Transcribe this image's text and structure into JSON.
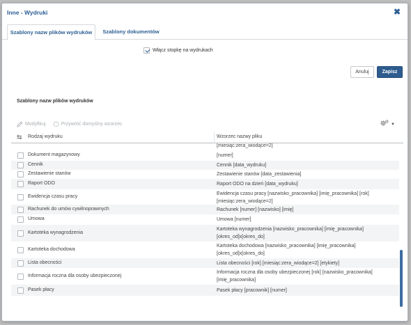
{
  "dialog": {
    "title": "Inne - Wydruki",
    "close_icon": "close-x-icon"
  },
  "tabs": [
    {
      "label": "Szablony nazw plików wydruków",
      "active": true
    },
    {
      "label": "Szablony dokumentów",
      "active": false
    }
  ],
  "footer_option": {
    "label": "Włącz stopkę na wydrukach",
    "checked": true
  },
  "buttons": {
    "cancel": "Anuluj",
    "save": "Zapisz"
  },
  "section": {
    "title": "Szablony nazw plików wydruków"
  },
  "toolbar": {
    "modify": {
      "label": "Modyfikuj",
      "icon": "pencil-icon"
    },
    "restore": {
      "label": "Przywróć domyślny wzorzec",
      "icon": "spinner-icon"
    },
    "settings_icon": "gears-icon"
  },
  "grid": {
    "columns": [
      "Rodzaj wydruku",
      "Wzorzec nazwy pliku"
    ],
    "partial_top_row": "[miesiąc:zera_wiodące=2]",
    "rows": [
      {
        "name": "Dokument magazynowy",
        "pattern": "[numer]"
      },
      {
        "name": "Cennik",
        "pattern": "Cennik [data_wydruku]"
      },
      {
        "name": "Zestawienie stanów",
        "pattern": "Zestawienie stanów [data_zestawienia]"
      },
      {
        "name": "Raport ODO",
        "pattern": "Raport ODO na dzień [data_wydruku]"
      },
      {
        "name": "Ewidencja czasu pracy",
        "pattern": "Ewidencja czasu pracy [nazwisko_pracownika] [imię_pracownika] [rok] [miesiąc:zera_wiodące=2]"
      },
      {
        "name": "Rachunek do umów cywilnoprawnych",
        "pattern": "Rachunek [numer] [nazwisko] [imię]"
      },
      {
        "name": "Umowa",
        "pattern": "Umowa [numer]"
      },
      {
        "name": "Kartoteka wynagrodzenia",
        "pattern": "Kartoteka wynagrodzenia [nazwisko_pracownika] [imię_pracownika] [okres_od]x[okres_do]"
      },
      {
        "name": "Kartoteka dochodowa",
        "pattern": "Kartoteka dochodowa [nazwisko_pracownika] [imię_pracownika] [okres_od]x[okres_do]"
      },
      {
        "name": "Lista obecności",
        "pattern": "Lista obecności [rok] [miesiąc:zera_wiodące=2] [etykiety]"
      },
      {
        "name": "Informacja roczna dla osoby ubezpieczonej",
        "pattern": "Informacja roczna dla osoby ubezpieczonej [rok] [nazwisko_pracownika] [imię_pracownika]"
      },
      {
        "name": "Pasek płacy",
        "pattern": "Pasek płacy [pracownik] [numer]"
      }
    ]
  },
  "colors": {
    "accent": "#2d5f93",
    "save_button": "#2f5c8f",
    "scrollbar": "#3e6da2"
  }
}
